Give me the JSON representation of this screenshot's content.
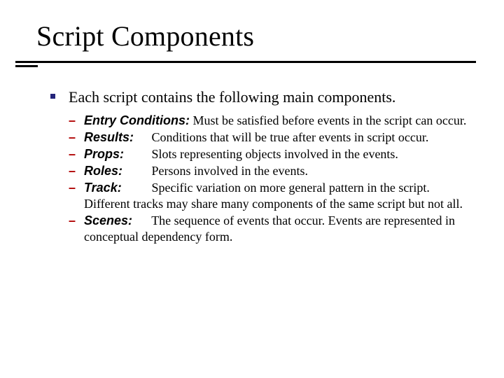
{
  "title": "Script Components",
  "main_bullet": "Each script contains the following main components.",
  "items": [
    {
      "term": "Entry Conditions",
      "def": " Must be satisfied before events in the script can occur."
    },
    {
      "term": "Results",
      "def": "Conditions that will be true after events in script occur."
    },
    {
      "term": "Props",
      "def": "Slots representing objects involved in the events."
    },
    {
      "term": "Roles",
      "def": "Persons involved in the events."
    },
    {
      "term": "Track",
      "def": "Specific variation on more general pattern in the script. Different tracks may share many components of the same script but not all."
    },
    {
      "term": "Scenes",
      "def": "The sequence of events that occur. Events are represented in conceptual dependency form."
    }
  ]
}
